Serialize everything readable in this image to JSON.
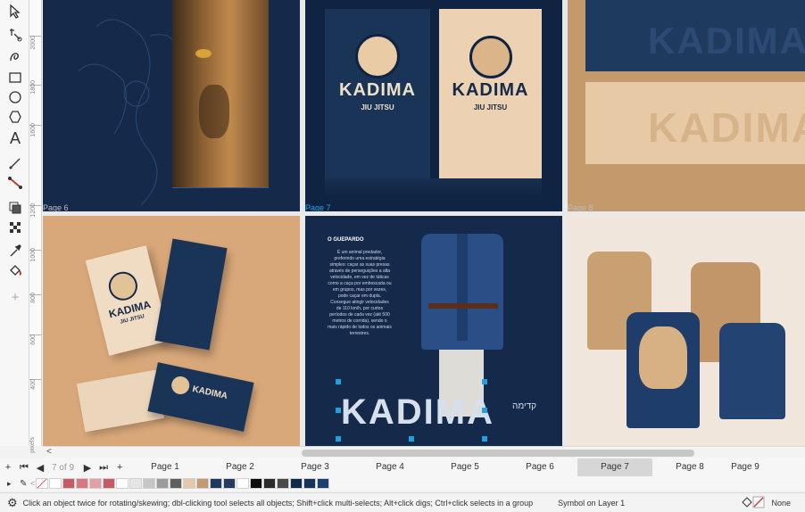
{
  "canvas": {
    "pages": [
      {
        "label": "Page 6"
      },
      {
        "label": "Page 7"
      },
      {
        "label": "Page 8"
      }
    ],
    "ruler_labels": [
      "2000",
      "1800",
      "1600",
      "1200",
      "1000",
      "800",
      "600",
      "400"
    ],
    "ruler_unit": "pixels",
    "brand_name": "KADIMA",
    "brand_sub": "JIU JITSU",
    "hebrew_text": "קדימה",
    "article_title": "O GUEPARDO",
    "article_body": "É um animal predador, preferindo uma estratégia simples: caçar as suas presas através de perseguições a alta velocidade, em vez de táticas como a caça por emboscada ou em grupos, mas por vezes, pode caçar em dupla. Consegue atingir velocidades de 110 km/h, por curtos períodos de cada vez (até 500 metros de corrida), sendo o mais rápido de todos os animais terrestres."
  },
  "pagebar": {
    "count": "7 of 9",
    "tabs": [
      "Page 1",
      "Page 2",
      "Page 3",
      "Page 4",
      "Page 5",
      "Page 6",
      "Page 7",
      "Page 8",
      "Page 9"
    ],
    "active_index": 6
  },
  "palette": {
    "colors": [
      "#ffffff",
      "#c95a63",
      "#d9777f",
      "#e2a0a5",
      "#c75b64",
      "#ffffff",
      "#e6e6e6",
      "#c6c6c6",
      "#9c9c9c",
      "#5f5f5f",
      "#e6c8a8",
      "#c49a6c",
      "#1e3a5f",
      "#243c62",
      "#ffffff",
      "#0a0a0a",
      "#2b2b2b",
      "#4a4a4a",
      "#0f2a4a",
      "#14325c",
      "#1a3f70"
    ]
  },
  "status": {
    "hint": "Click an object twice for rotating/skewing; dbl-clicking tool selects all objects; Shift+click multi-selects; Alt+click digs; Ctrl+click selects in a group",
    "layer": "Symbol on Layer 1",
    "fill_label": "None"
  },
  "colors": {
    "navy": "#15294a",
    "tan": "#d4a57c",
    "accent_blue": "#1ba3e0"
  }
}
